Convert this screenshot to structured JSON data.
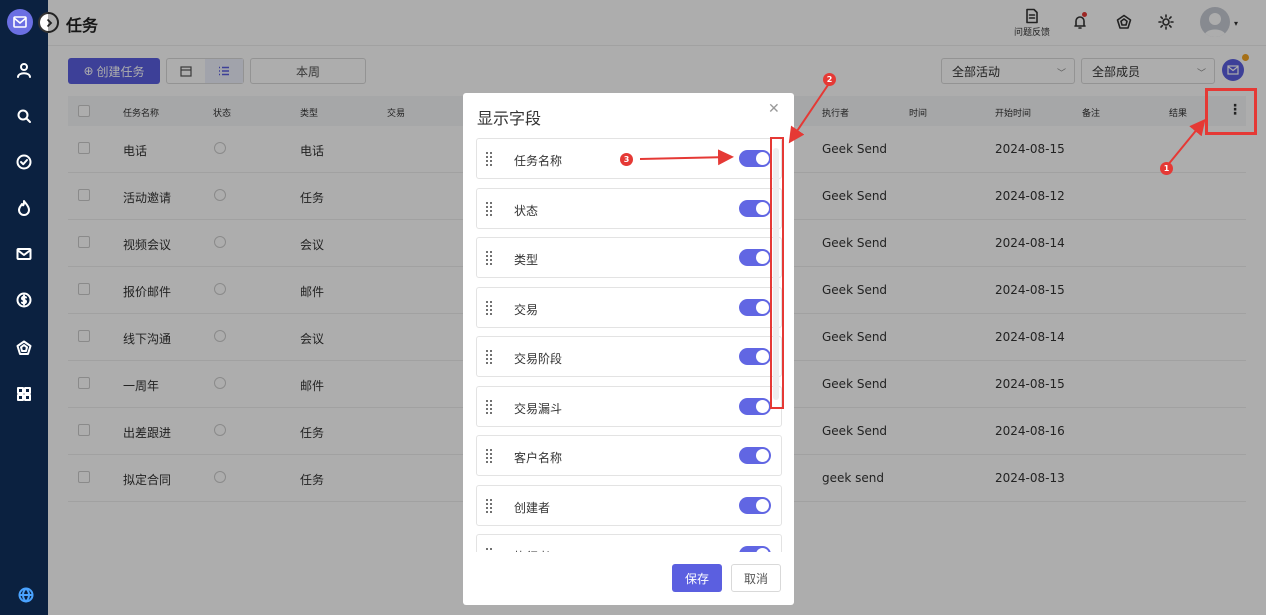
{
  "app": {
    "title": "任务"
  },
  "topbar": {
    "feedback_label": "问题反馈"
  },
  "toolbar": {
    "create_label": "创建任务",
    "week_label": "本周",
    "activity_filter": "全部活动",
    "member_filter": "全部成员"
  },
  "table": {
    "headers": [
      "任务名称",
      "状态",
      "类型",
      "交易",
      "执行者",
      "时间",
      "开始时间",
      "备注",
      "结果"
    ],
    "rows": [
      {
        "name": "电话",
        "type": "电话",
        "assignee": "Geek Send",
        "start": "2024-08-15"
      },
      {
        "name": "活动邀请",
        "type": "任务",
        "assignee": "Geek Send",
        "start": "2024-08-12"
      },
      {
        "name": "视频会议",
        "type": "会议",
        "assignee": "Geek Send",
        "start": "2024-08-14"
      },
      {
        "name": "报价邮件",
        "type": "邮件",
        "assignee": "Geek Send",
        "start": "2024-08-15"
      },
      {
        "name": "线下沟通",
        "type": "会议",
        "assignee": "Geek Send",
        "start": "2024-08-14"
      },
      {
        "name": "一周年",
        "type": "邮件",
        "assignee": "Geek Send",
        "start": "2024-08-15"
      },
      {
        "name": "出差跟进",
        "type": "任务",
        "assignee": "Geek Send",
        "start": "2024-08-16"
      },
      {
        "name": "拟定合同",
        "type": "任务",
        "assignee": "geek send",
        "start": "2024-08-13"
      }
    ]
  },
  "modal": {
    "title": "显示字段",
    "fields": [
      {
        "label": "任务名称",
        "enabled": true
      },
      {
        "label": "状态",
        "enabled": true
      },
      {
        "label": "类型",
        "enabled": true
      },
      {
        "label": "交易",
        "enabled": true
      },
      {
        "label": "交易阶段",
        "enabled": true
      },
      {
        "label": "交易漏斗",
        "enabled": true
      },
      {
        "label": "客户名称",
        "enabled": true
      },
      {
        "label": "创建者",
        "enabled": true
      },
      {
        "label": "执行者",
        "enabled": true
      }
    ],
    "save_label": "保存",
    "cancel_label": "取消"
  },
  "annotations": {
    "step1": "1",
    "step2": "2",
    "step3": "3"
  },
  "colors": {
    "sidebar": "#0b2140",
    "primary": "#5b5fe0",
    "highlight": "#e53935"
  }
}
